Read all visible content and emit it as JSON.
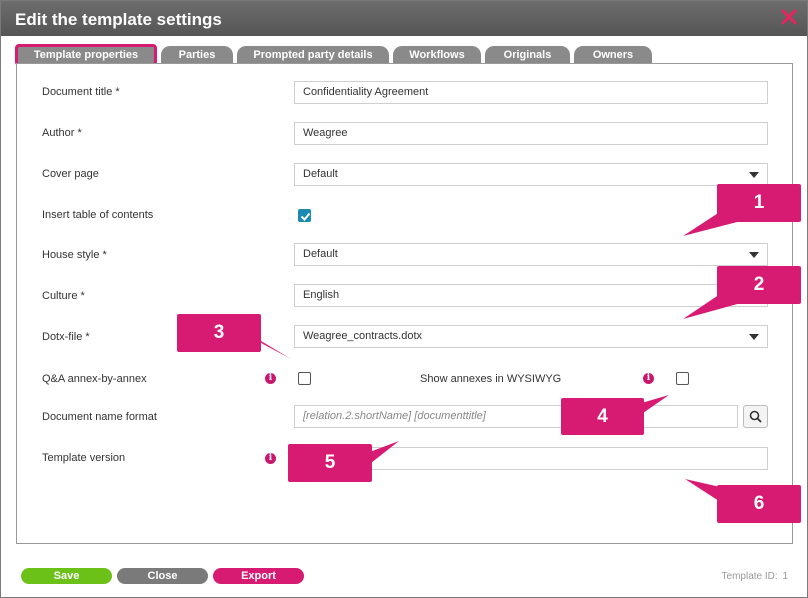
{
  "dialog": {
    "title": "Edit the template settings",
    "close_icon": "close-x-icon"
  },
  "tabs": [
    {
      "label": "Template properties",
      "active": true
    },
    {
      "label": "Parties",
      "active": false
    },
    {
      "label": "Prompted party details",
      "active": false
    },
    {
      "label": "Workflows",
      "active": false
    },
    {
      "label": "Originals",
      "active": false
    },
    {
      "label": "Owners",
      "active": false
    }
  ],
  "form": {
    "document_title": {
      "label": "Document title *",
      "value": "Confidentiality Agreement"
    },
    "author": {
      "label": "Author *",
      "value": "Weagree"
    },
    "cover_page": {
      "label": "Cover page",
      "value": "Default"
    },
    "insert_toc": {
      "label": "Insert table of contents",
      "checked": true
    },
    "house_style": {
      "label": "House style *",
      "value": "Default"
    },
    "culture": {
      "label": "Culture *",
      "value": "English"
    },
    "dotx_file": {
      "label": "Dotx-file *",
      "value": "Weagree_contracts.dotx"
    },
    "qa_annex": {
      "label": "Q&A annex-by-annex",
      "checked": false
    },
    "show_annexes": {
      "label": "Show annexes in WYSIWYG",
      "checked": false
    },
    "doc_name_format": {
      "label": "Document name format",
      "placeholder": "[relation.2.shortName] [documenttitle]"
    },
    "template_version": {
      "label": "Template version",
      "value": ""
    }
  },
  "callouts": [
    "1",
    "2",
    "3",
    "4",
    "5",
    "6"
  ],
  "footer": {
    "save": "Save",
    "close": "Close",
    "export": "Export",
    "template_id_label": "Template ID:",
    "template_id_value": "1"
  },
  "colors": {
    "accent": "#d81b72",
    "save_green": "#6cc118",
    "neutral_gray": "#7a7a7a",
    "checkbox_blue": "#1a8ab3"
  }
}
